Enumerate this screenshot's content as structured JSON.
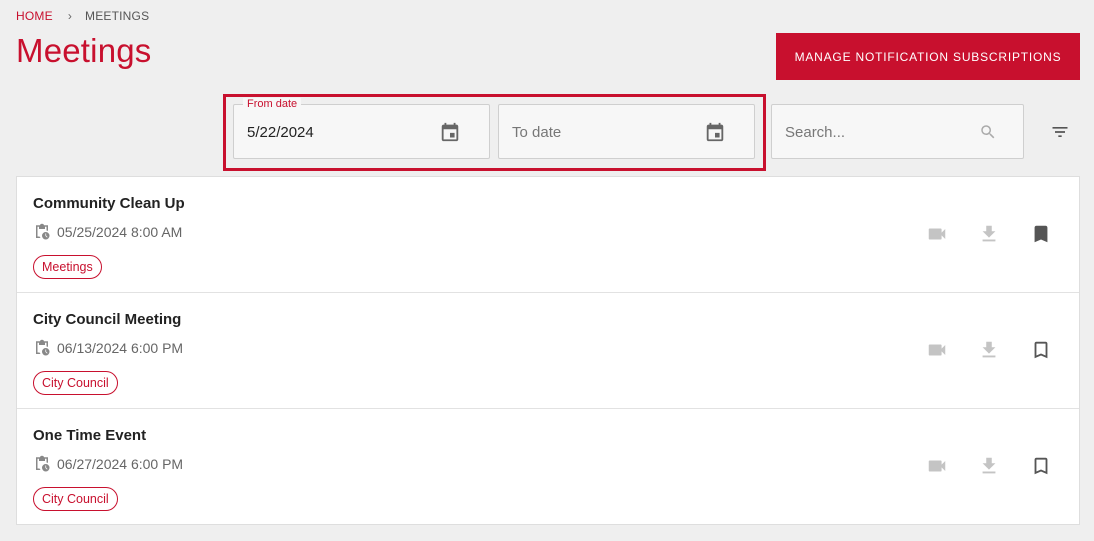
{
  "breadcrumb": {
    "home": "HOME",
    "current": "MEETINGS"
  },
  "page_title": "Meetings",
  "manage_button": "MANAGE NOTIFICATION SUBSCRIPTIONS",
  "filters": {
    "from_date": {
      "label": "From date",
      "value": "5/22/2024",
      "icon": "calendar-icon"
    },
    "to_date": {
      "placeholder": "To date",
      "icon": "calendar-icon"
    },
    "search": {
      "placeholder": "Search...",
      "icon": "search-icon"
    },
    "filter_icon": "filter-icon"
  },
  "colors": {
    "accent": "#c8102e",
    "background": "#efefef",
    "card": "#ffffff",
    "icon_muted": "#bdbdbd",
    "icon_dark": "#555555"
  },
  "meetings": [
    {
      "title": "Community Clean Up",
      "datetime": "05/25/2024 8:00 AM",
      "tag": "Meetings",
      "bookmarked": true
    },
    {
      "title": "City Council Meeting",
      "datetime": "06/13/2024 6:00 PM",
      "tag": "City Council",
      "bookmarked": false
    },
    {
      "title": "One Time Event",
      "datetime": "06/27/2024 6:00 PM",
      "tag": "City Council",
      "bookmarked": false
    }
  ]
}
